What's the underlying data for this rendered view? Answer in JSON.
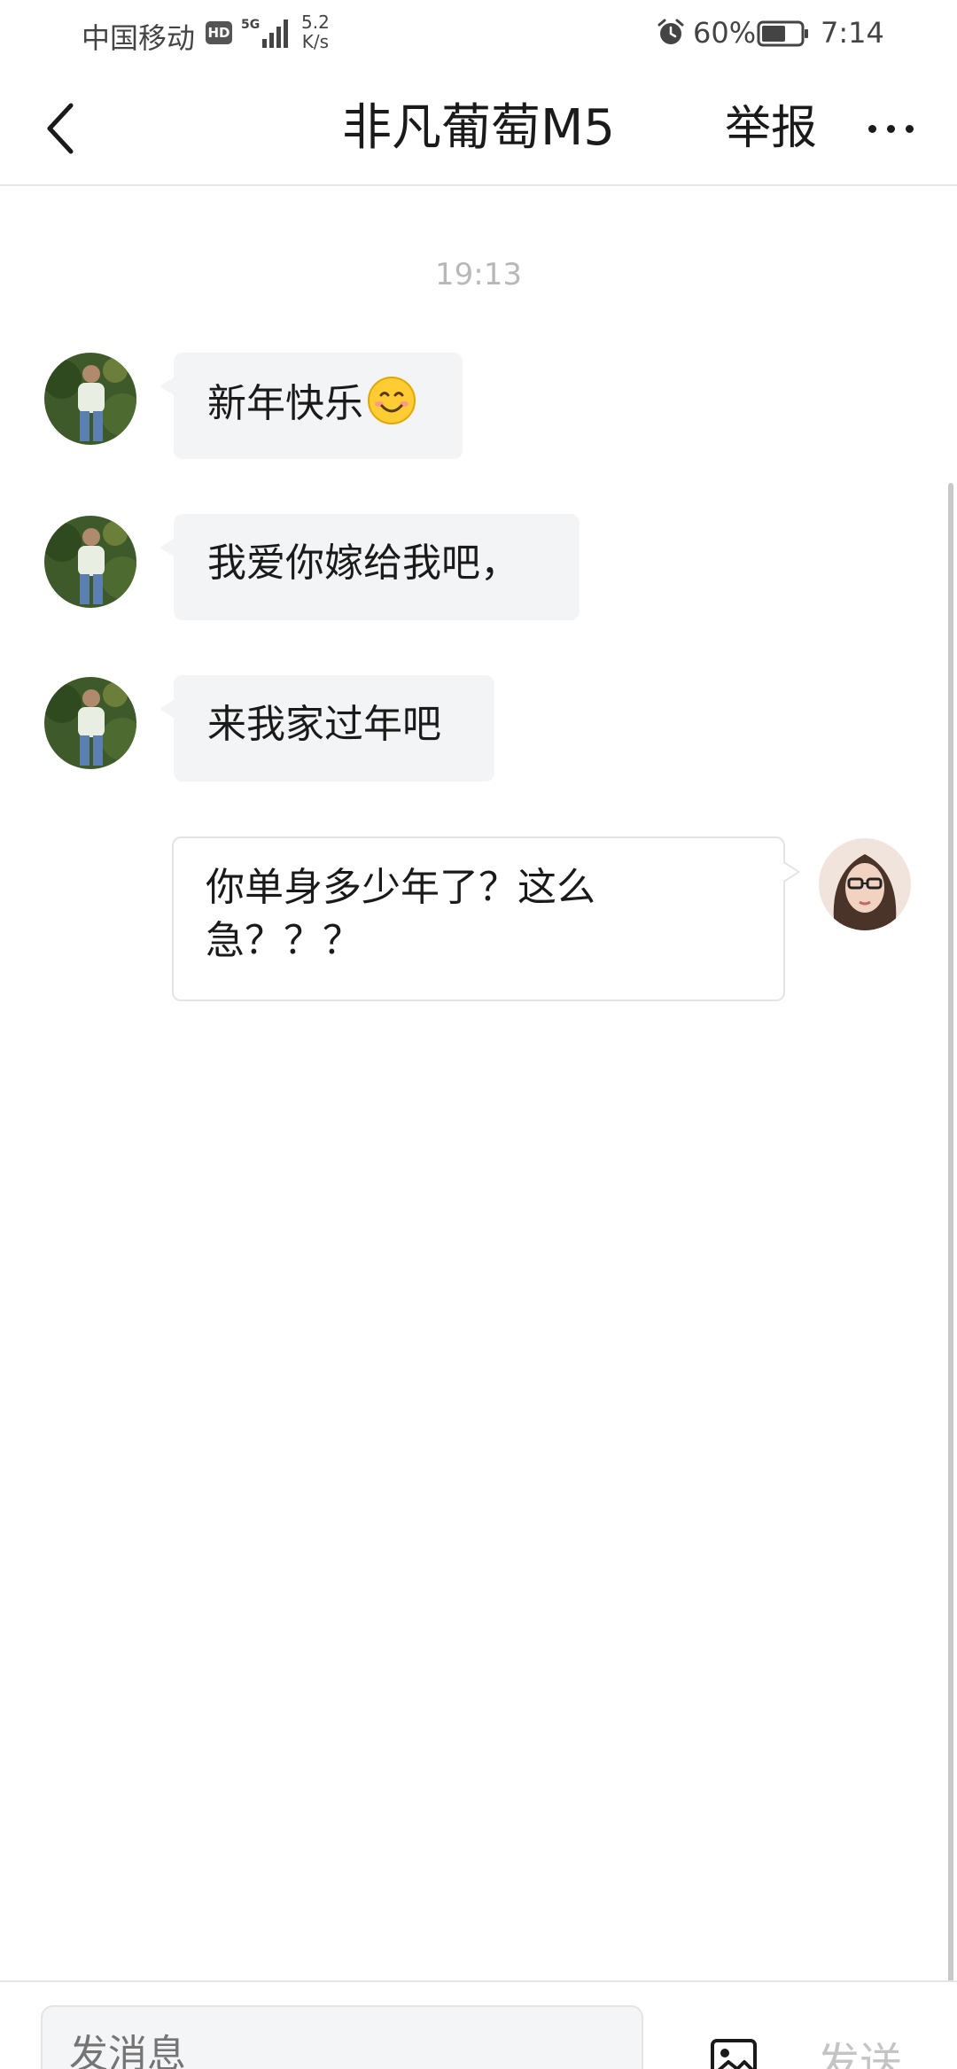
{
  "status_bar": {
    "carrier": "中国移动",
    "hd": "HD",
    "network": "5G",
    "speed_value": "5.2",
    "speed_unit": "K/s",
    "battery": "60%",
    "time": "7:14"
  },
  "header": {
    "title": "非凡葡萄M5",
    "report": "举报"
  },
  "conversation": {
    "timestamp": "19:13",
    "messages": [
      {
        "from": "other",
        "text": "新年快乐",
        "emoji": "smiling-face"
      },
      {
        "from": "other",
        "text": "我爱你嫁给我吧，"
      },
      {
        "from": "other",
        "text": "来我家过年吧"
      },
      {
        "from": "me",
        "line1": "你单身多少年了？这么",
        "line2": "急？？？"
      }
    ]
  },
  "input_bar": {
    "placeholder": "发消息",
    "send": "发送"
  },
  "colors": {
    "incoming_bubble": "#f3f4f6",
    "outgoing_border": "#e3e3e3",
    "timestamp": "#b8b8b8",
    "send_disabled": "#c4c4c4"
  }
}
